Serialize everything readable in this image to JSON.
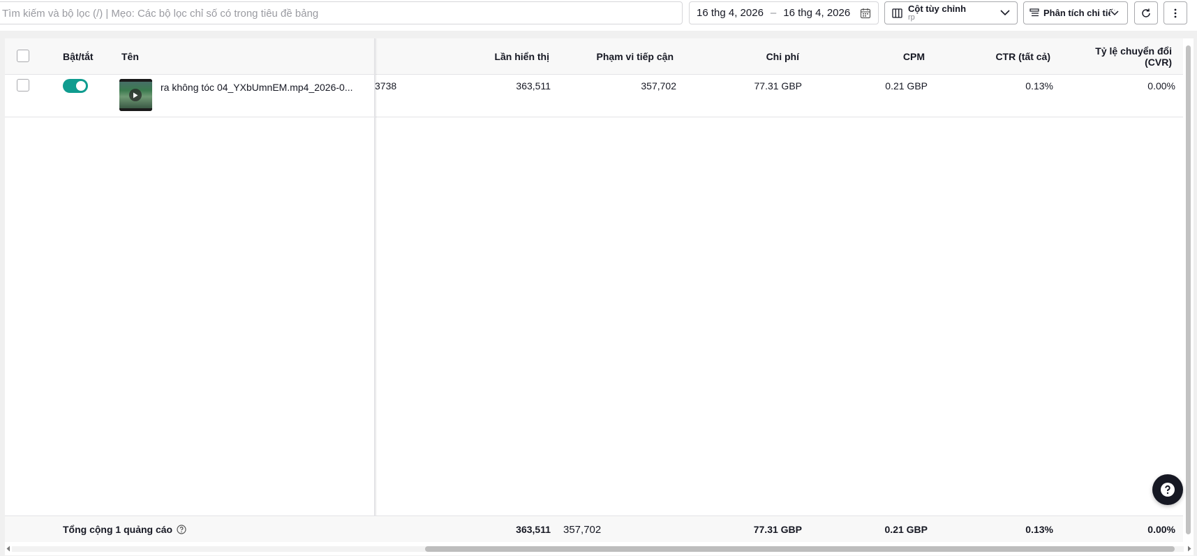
{
  "toolbar": {
    "search_placeholder": "Tìm kiếm và bộ lọc (/) | Mẹo: Các bộ lọc chỉ số có trong tiêu đề bảng",
    "date_start": "16 thg 4, 2026",
    "date_sep": "–",
    "date_end": "16 thg 4, 2026",
    "custom_columns_label": "Cột tùy chỉnh",
    "custom_columns_sub": "rp",
    "breakdown_label": "Phân tích chi tiết",
    "icons": [
      "calendar-icon",
      "columns-icon",
      "chevron-down-icon",
      "breakdown-icon",
      "refresh-icon",
      "more-icon"
    ]
  },
  "table": {
    "headers": {
      "toggle": "Bật/tắt",
      "name": "Tên",
      "impressions": "Lần hiển thị",
      "reach": "Phạm vi tiếp cận",
      "cost": "Chi phí",
      "cpm": "CPM",
      "ctr": "CTR (tất cả)",
      "cvr_line1": "Tỷ lệ chuyển đổi",
      "cvr_line2": "(CVR)"
    },
    "rows": [
      {
        "toggle_on": true,
        "name": "ra không tóc 04_YXbUmnEM.mp4_2026-0...",
        "hidden_col_tail": "3738",
        "impressions": "363,511",
        "reach": "357,702",
        "cost": "77.31 GBP",
        "cpm": "0.21 GBP",
        "ctr": "0.13%",
        "cvr": "0.00%"
      }
    ],
    "footer": {
      "label": "Tổng cộng 1 quảng cáo",
      "impressions": "363,511",
      "reach": "357,702",
      "cost": "77.31 GBP",
      "cpm": "0.21 GBP",
      "ctr": "0.13%",
      "cvr": "0.00%"
    }
  },
  "colors": {
    "accent": "#0f9c8f",
    "border": "#d6d6d9",
    "text": "#161823"
  }
}
